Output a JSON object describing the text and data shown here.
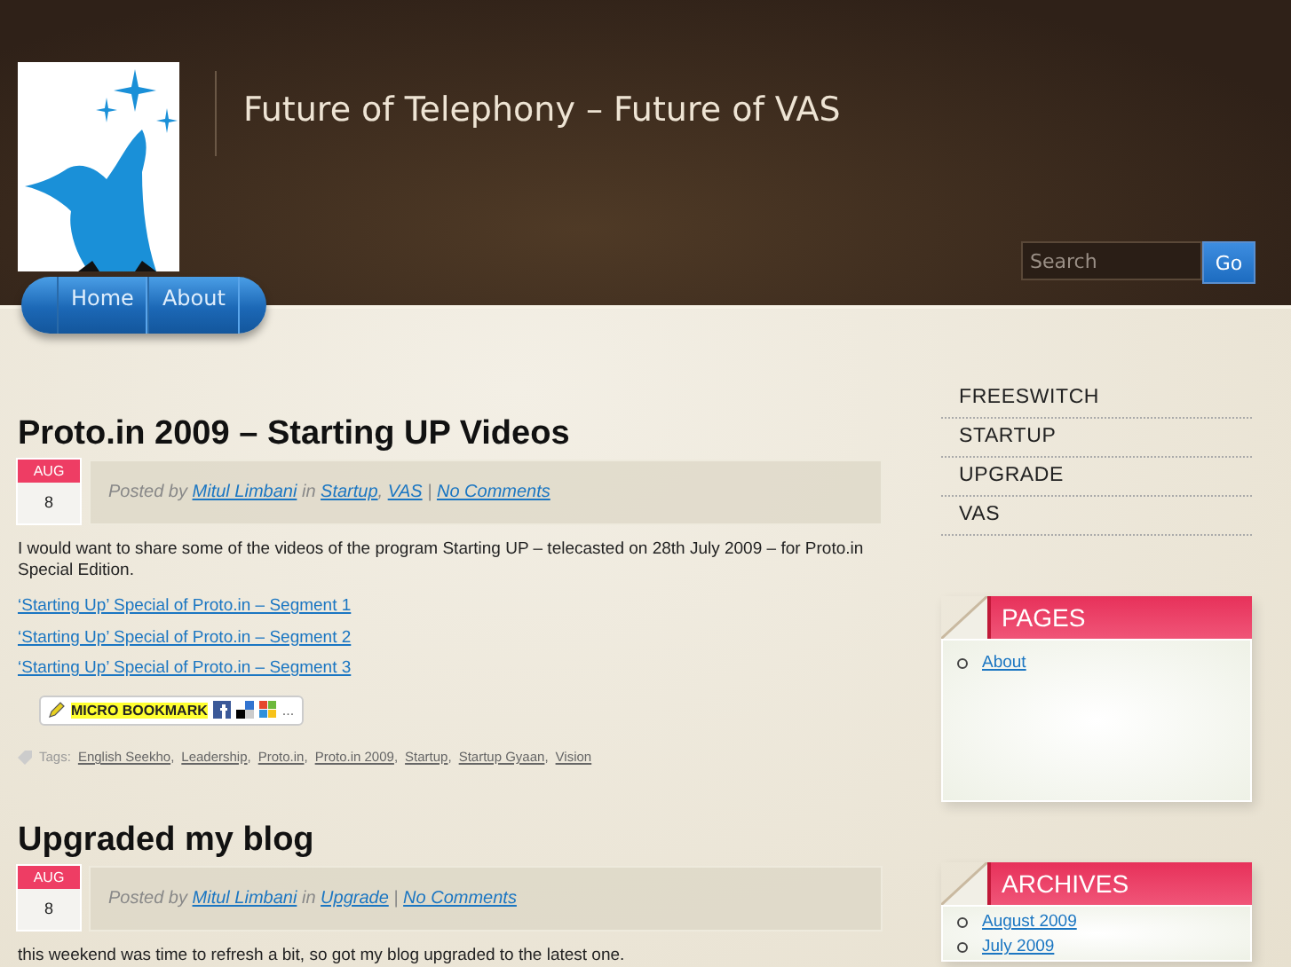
{
  "site": {
    "title": "Future of Telephony – Future of VAS"
  },
  "search": {
    "placeholder": "Search",
    "button": "Go"
  },
  "nav": [
    {
      "label": "Home"
    },
    {
      "label": "About"
    }
  ],
  "posts": [
    {
      "title": "Proto.in 2009 – Starting UP Videos",
      "date": {
        "month": "AUG",
        "day": "8"
      },
      "meta": {
        "prefix": "Posted by",
        "author": "Mitul Limbani",
        "joiner": "in",
        "categories": [
          "Startup",
          "VAS"
        ],
        "separator": ",",
        "divider": "|",
        "comments": "No Comments"
      },
      "body": "I would want to share some of the videos of the program Starting UP – telecasted on 28th July 2009 – for Proto.in Special Edition.",
      "links": [
        "‘Starting Up’ Special of Proto.in – Segment 1",
        "‘Starting Up’ Special of Proto.in – Segment 2",
        "‘Starting Up’ Special of Proto.in – Segment 3"
      ],
      "bookmark": {
        "label": "MICRO BOOKMARK",
        "more": "..."
      },
      "tags_label": "Tags:",
      "tags": [
        "English Seekho",
        "Leadership",
        "Proto.in",
        "Proto.in 2009",
        "Startup",
        "Startup Gyaan",
        "Vision"
      ],
      "tags_separator": ","
    },
    {
      "title": "Upgraded my blog",
      "date": {
        "month": "AUG",
        "day": "8"
      },
      "meta": {
        "prefix": "Posted by",
        "author": "Mitul Limbani",
        "joiner": "in",
        "categories": [
          "Upgrade"
        ],
        "divider": "|",
        "comments": "No Comments"
      },
      "body": "this weekend was time to refresh a bit, so got my blog upgraded to the latest one."
    }
  ],
  "sidebar": {
    "categories": [
      "FREESWITCH",
      "STARTUP",
      "UPGRADE",
      "VAS"
    ],
    "widgets": [
      {
        "title": "PAGES",
        "links": [
          "About"
        ]
      },
      {
        "title": "ARCHIVES",
        "links": [
          "August 2009",
          "July 2009"
        ]
      }
    ]
  }
}
